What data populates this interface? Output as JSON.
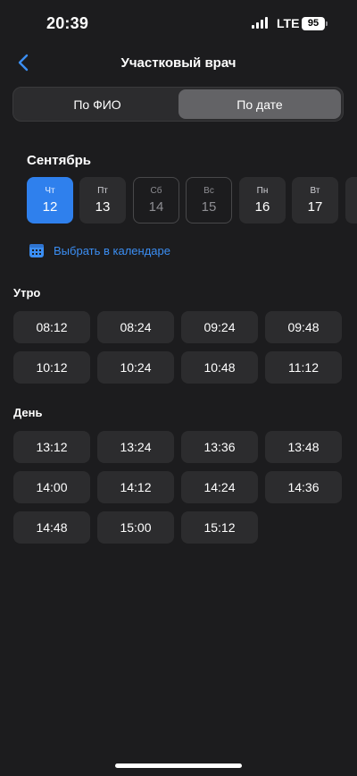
{
  "status_bar": {
    "time": "20:39",
    "network": "LTE",
    "battery": "95"
  },
  "nav": {
    "title": "Участковый врач",
    "back_icon": "chevron-left-icon"
  },
  "segment": {
    "options": [
      "По ФИО",
      "По дате"
    ],
    "selected": "По дате"
  },
  "month": "Сентябрь",
  "days": [
    {
      "dow": "Чт",
      "num": "12",
      "state": "selected"
    },
    {
      "dow": "Пт",
      "num": "13",
      "state": "available"
    },
    {
      "dow": "Сб",
      "num": "14",
      "state": "disabled"
    },
    {
      "dow": "Вс",
      "num": "15",
      "state": "disabled"
    },
    {
      "dow": "Пн",
      "num": "16",
      "state": "available"
    },
    {
      "dow": "Вт",
      "num": "17",
      "state": "available"
    }
  ],
  "calendar_link": {
    "icon": "calendar-icon",
    "label": "Выбрать в календаре"
  },
  "sections": [
    {
      "title": "Утро",
      "slots": [
        "08:12",
        "08:24",
        "09:24",
        "09:48",
        "10:12",
        "10:24",
        "10:48",
        "11:12"
      ]
    },
    {
      "title": "День",
      "slots": [
        "13:12",
        "13:24",
        "13:36",
        "13:48",
        "14:00",
        "14:12",
        "14:24",
        "14:36",
        "14:48",
        "15:00",
        "15:12"
      ]
    }
  ],
  "colors": {
    "background": "#1c1c1e",
    "accent": "#2f80ed",
    "link": "#3b8ef3",
    "tile": "#2c2c2e"
  }
}
